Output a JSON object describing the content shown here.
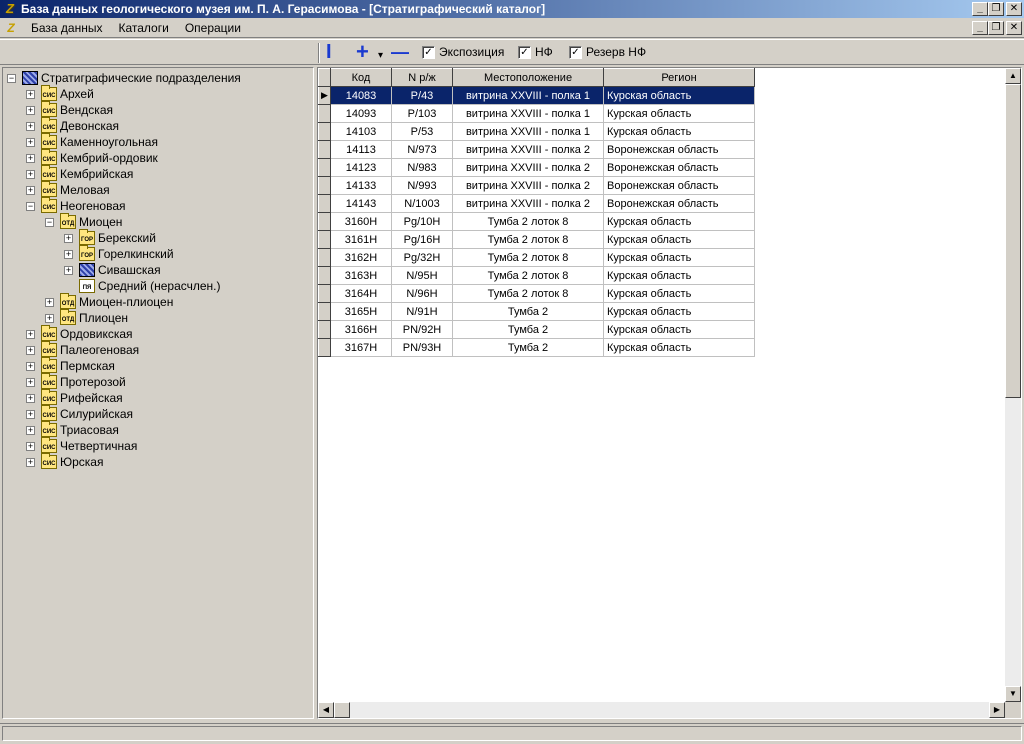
{
  "window": {
    "title": "База данных геологического музея им. П. А. Герасимова - [Стратиграфический каталог]",
    "app_icon_glyph": "Z",
    "buttons": {
      "minimize": "_",
      "restore": "❐",
      "close": "✕"
    }
  },
  "menu": {
    "items": [
      "База данных",
      "Каталоги",
      "Операции"
    ]
  },
  "toolbar": {
    "icons": {
      "cursor": "I",
      "add": "+",
      "dropdown": "▾",
      "remove": "—"
    },
    "checkboxes": [
      {
        "label": "Экспозиция",
        "checked": true,
        "mark": "✓"
      },
      {
        "label": "НФ",
        "checked": true,
        "mark": "✓"
      },
      {
        "label": "Резерв НФ",
        "checked": true,
        "mark": "✓"
      }
    ]
  },
  "tree": {
    "nodes": [
      {
        "label": "Стратиграфические подразделения",
        "level": 0,
        "expander": "−",
        "icon": "hatch",
        "tag": ""
      },
      {
        "label": "Архей",
        "level": 1,
        "expander": "+",
        "icon": "folder",
        "tag": "СИС"
      },
      {
        "label": "Вендская",
        "level": 1,
        "expander": "+",
        "icon": "folder",
        "tag": "СИС"
      },
      {
        "label": "Девонская",
        "level": 1,
        "expander": "+",
        "icon": "folder",
        "tag": "СИС"
      },
      {
        "label": "Каменноугольная",
        "level": 1,
        "expander": "+",
        "icon": "folder",
        "tag": "СИС"
      },
      {
        "label": "Кембрий-ордовик",
        "level": 1,
        "expander": "+",
        "icon": "folder",
        "tag": "СИС"
      },
      {
        "label": "Кембрийская",
        "level": 1,
        "expander": "+",
        "icon": "folder",
        "tag": "СИС"
      },
      {
        "label": "Меловая",
        "level": 1,
        "expander": "+",
        "icon": "folder",
        "tag": "СИС"
      },
      {
        "label": "Неогеновая",
        "level": 1,
        "expander": "−",
        "icon": "folder",
        "tag": "СИС"
      },
      {
        "label": "Миоцен",
        "level": 2,
        "expander": "−",
        "icon": "folder",
        "tag": "ОТД"
      },
      {
        "label": "Берекский",
        "level": 3,
        "expander": "+",
        "icon": "folder",
        "tag": "ГОР"
      },
      {
        "label": "Горелкинский",
        "level": 3,
        "expander": "+",
        "icon": "folder",
        "tag": "ГОР"
      },
      {
        "label": "Сивашская",
        "level": 3,
        "expander": "+",
        "icon": "hatch",
        "tag": ""
      },
      {
        "label": "Средний (нерасчлен.)",
        "level": 3,
        "expander": "",
        "icon": "plain",
        "tag": "ПЯ"
      },
      {
        "label": "Миоцен-плиоцен",
        "level": 2,
        "expander": "+",
        "icon": "folder",
        "tag": "ОТД"
      },
      {
        "label": "Плиоцен",
        "level": 2,
        "expander": "+",
        "icon": "folder",
        "tag": "ОТД"
      },
      {
        "label": "Ордовикская",
        "level": 1,
        "expander": "+",
        "icon": "folder",
        "tag": "СИС"
      },
      {
        "label": "Палеогеновая",
        "level": 1,
        "expander": "+",
        "icon": "folder",
        "tag": "СИС"
      },
      {
        "label": "Пермская",
        "level": 1,
        "expander": "+",
        "icon": "folder",
        "tag": "СИС"
      },
      {
        "label": "Протерозой",
        "level": 1,
        "expander": "+",
        "icon": "folder",
        "tag": "СИС"
      },
      {
        "label": "Рифейская",
        "level": 1,
        "expander": "+",
        "icon": "folder",
        "tag": "СИС"
      },
      {
        "label": "Силурийская",
        "level": 1,
        "expander": "+",
        "icon": "folder",
        "tag": "СИС"
      },
      {
        "label": "Триасовая",
        "level": 1,
        "expander": "+",
        "icon": "folder",
        "tag": "СИС"
      },
      {
        "label": "Четвертичная",
        "level": 1,
        "expander": "+",
        "icon": "folder",
        "tag": "СИС"
      },
      {
        "label": "Юрская",
        "level": 1,
        "expander": "+",
        "icon": "folder",
        "tag": "СИС"
      }
    ]
  },
  "grid": {
    "columns": [
      "Код",
      "N р/ж",
      "Местоположение",
      "Регион"
    ],
    "current_row_marker": "▶",
    "selected_index": 0,
    "rows": [
      [
        "14083",
        "Р/43",
        "витрина XXVIII - полка 1",
        "Курская область"
      ],
      [
        "14093",
        "Р/103",
        "витрина XXVIII - полка 1",
        "Курская область"
      ],
      [
        "14103",
        "Р/53",
        "витрина XXVIII - полка 1",
        "Курская область"
      ],
      [
        "14113",
        "N/973",
        "витрина XXVIII - полка 2",
        "Воронежская область"
      ],
      [
        "14123",
        "N/983",
        "витрина XXVIII - полка 2",
        "Воронежская область"
      ],
      [
        "14133",
        "N/993",
        "витрина XXVIII - полка 2",
        "Воронежская область"
      ],
      [
        "14143",
        "N/1003",
        "витрина XXVIII - полка 2",
        "Воронежская область"
      ],
      [
        "3160Н",
        "Pg/10Н",
        "Тумба 2 лоток 8",
        "Курская область"
      ],
      [
        "3161Н",
        "Pg/16Н",
        "Тумба 2 лоток 8",
        "Курская область"
      ],
      [
        "3162Н",
        "Pg/32Н",
        "Тумба 2 лоток 8",
        "Курская область"
      ],
      [
        "3163Н",
        "N/95Н",
        "Тумба 2 лоток 8",
        "Курская область"
      ],
      [
        "3164Н",
        "N/96Н",
        "Тумба 2 лоток 8",
        "Курская область"
      ],
      [
        "3165Н",
        "N/91Н",
        "Тумба 2",
        "Курская область"
      ],
      [
        "3166Н",
        "PN/92Н",
        "Тумба 2",
        "Курская область"
      ],
      [
        "3167Н",
        "PN/93Н",
        "Тумба 2",
        "Курская область"
      ]
    ]
  },
  "scrollbars": {
    "up": "▲",
    "down": "▼",
    "left": "◀",
    "right": "▶"
  }
}
